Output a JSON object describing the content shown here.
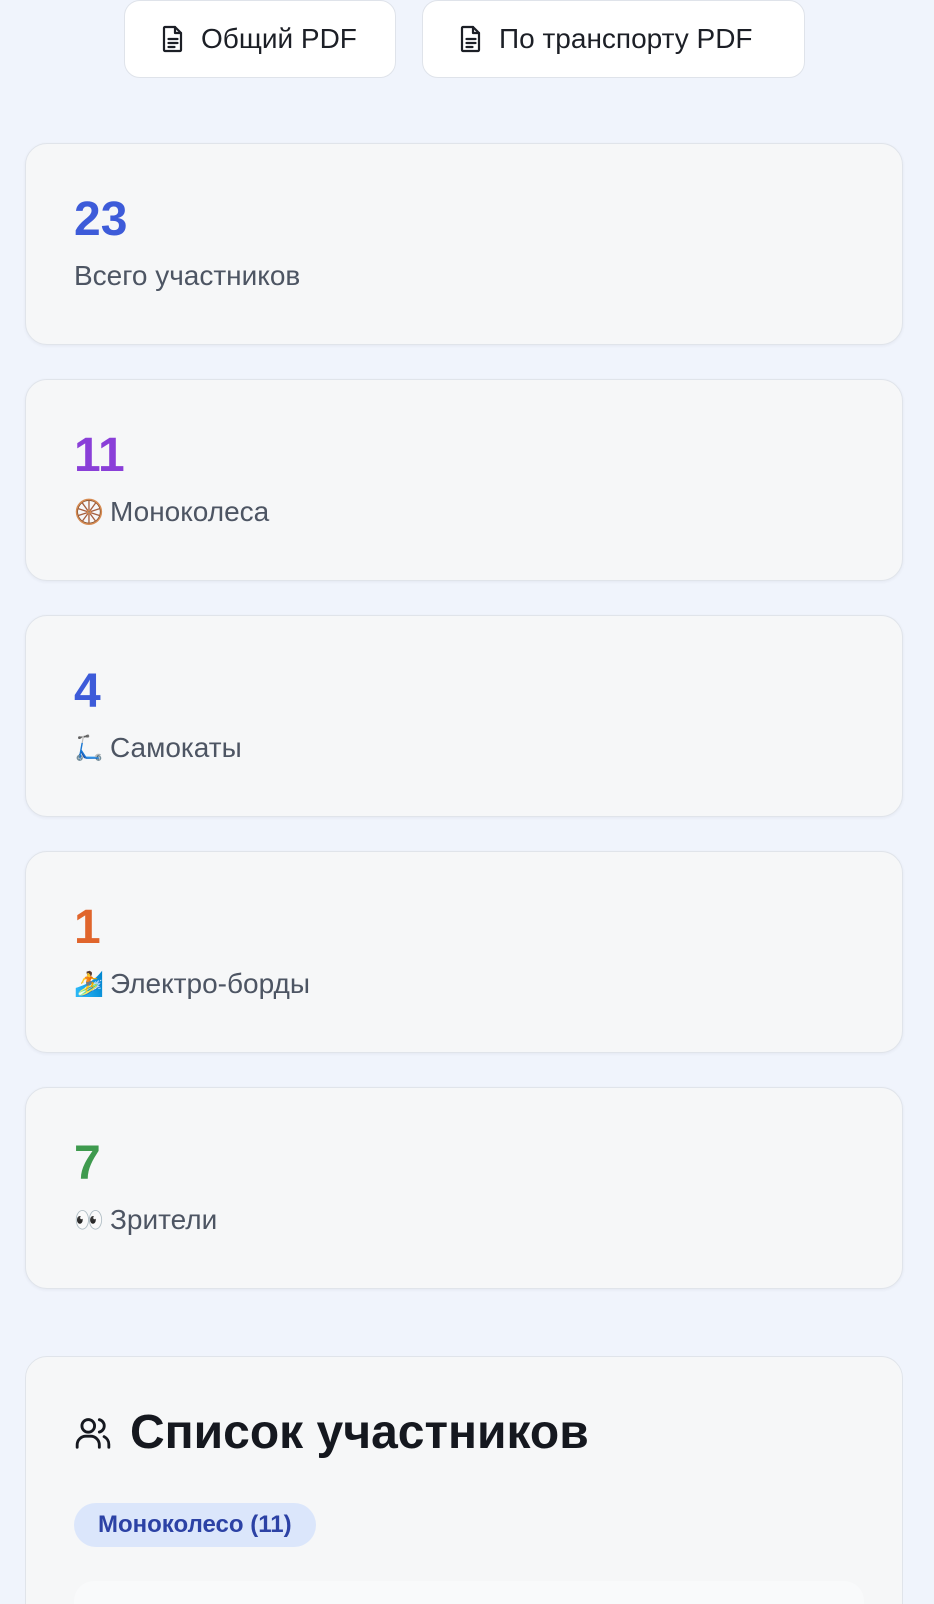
{
  "actions": {
    "general_pdf": "Общий PDF",
    "transport_pdf": "По транспорту PDF"
  },
  "stats": [
    {
      "value": "23",
      "label": "Всего участников",
      "emoji": "",
      "color": "#3d5bd9"
    },
    {
      "value": "11",
      "label": "Моноколеса",
      "emoji": "🛞",
      "color": "#8a3fd8"
    },
    {
      "value": "4",
      "label": "Самокаты",
      "emoji": "🛴",
      "color": "#3d5bd9"
    },
    {
      "value": "1",
      "label": "Электро-борды",
      "emoji": "🏄",
      "color": "#e0652c"
    },
    {
      "value": "7",
      "label": "Зрители",
      "emoji": "👀",
      "color": "#3e9a4e"
    }
  ],
  "participants": {
    "title": "Список участников",
    "filter_chip": "Моноколесо (11)"
  }
}
